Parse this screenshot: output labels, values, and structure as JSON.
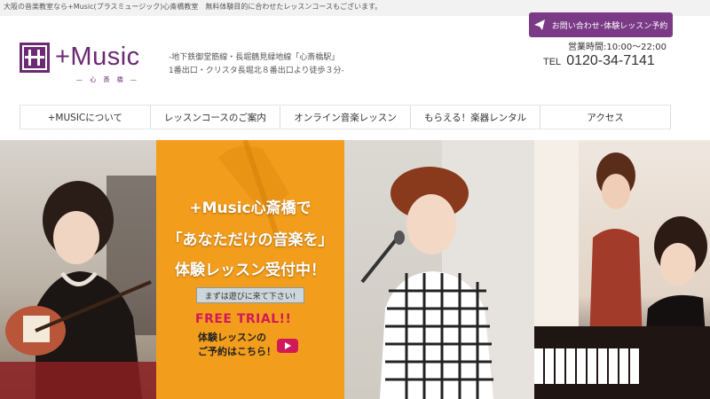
{
  "topbar": {
    "tagline": "大阪の音楽教室なら+Music(プラスミュージック)心斎橋教室　無料体験目的に合わせたレッスンコースもございます。"
  },
  "logo": {
    "brand": "+Music",
    "sub": "— 心 斎 橋 —"
  },
  "address": {
    "line1": "-地下鉄御堂筋線・長堀鶴見緑地線「心斎橋駅」",
    "line2": "1番出口・クリスタ長堀北８番出口より徒歩３分-"
  },
  "contact": {
    "button_label": "お問い合わせ･体験レッスン予約",
    "hours": "営業時間:10:00〜22:00",
    "tel_label": "TEL",
    "tel_number": "0120-34-7141"
  },
  "nav": {
    "items": [
      {
        "label": "+MUSICについて"
      },
      {
        "label": "レッスンコースのご案内"
      },
      {
        "label": "オンライン音楽レッスン"
      },
      {
        "label": "もらえる！楽器レンタル"
      },
      {
        "label": "アクセス"
      }
    ]
  },
  "hero": {
    "line1": "+Music心斎橋で",
    "line2": "「あなただけの音楽を」",
    "line3": "体験レッスン受付中！",
    "tag": "まずは遊びに来て下さい!",
    "free": "FREE TRIAL!!",
    "reserve1": "体験レッスンの",
    "reserve2": "ご予約はこちら！"
  },
  "colors": {
    "brand_purple": "#6b2a73",
    "button_purple": "#7a3a86",
    "hero_orange": "#f39d1c",
    "accent_pink": "#d1195a"
  },
  "icons": {
    "contact": "paper-plane-icon",
    "play": "play-icon",
    "logo_mark": "plus-music-logo-icon"
  }
}
